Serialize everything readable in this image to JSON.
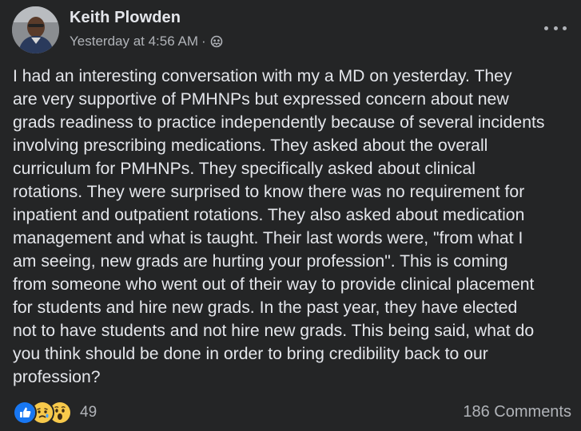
{
  "post": {
    "author_name": "Keith Plowden",
    "timestamp": "Yesterday at 4:56 AM",
    "separator": "·",
    "audience_icon": "group-members-icon",
    "more_icon": "more-options-icon",
    "body_lines": [
      "I had an interesting conversation with my a MD on yesterday.  They",
      "are very supportive of PMHNPs but expressed concern about new",
      "grads readiness to practice independently because of several incidents",
      "involving prescribing medications.  They asked about the overall",
      "curriculum for PMHNPs.  They specifically asked about clinical",
      "rotations.  They were surprised to know there was no requirement for",
      "inpatient and outpatient rotations.  They also asked about medication",
      "management and what is taught.  Their last words were, \"from what I",
      "am seeing, new grads are hurting your profession\".  This is coming",
      "from someone who went out of their way to provide clinical placement",
      "for students and hire new grads. In the past year, they have elected",
      "not to have students and not hire new grads.  This being said, what do",
      "you think should be done in order to bring credibility back to our",
      "profession?"
    ]
  },
  "footer": {
    "reactions": [
      "like-icon",
      "sad-icon",
      "wow-icon"
    ],
    "reaction_count": "49",
    "comments_label": "186 Comments"
  },
  "colors": {
    "background": "#242526",
    "primary_text": "#e4e6eb",
    "secondary_text": "#b0b3b8",
    "like_blue": "#1877f2",
    "emoji_yellow": "#f7c94b"
  }
}
